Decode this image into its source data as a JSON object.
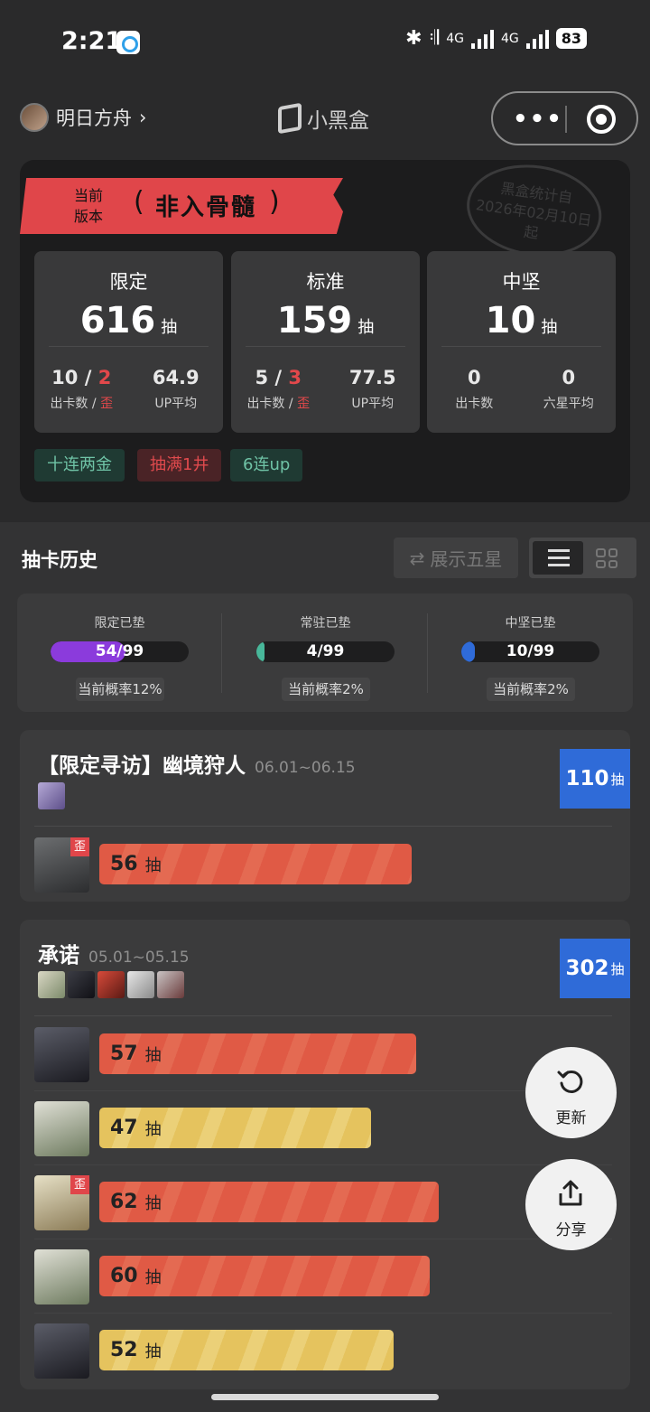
{
  "status": {
    "time": "2:21",
    "net1": "4G",
    "net2": "4G",
    "battery": "83"
  },
  "nav": {
    "game": "明日方舟",
    "brand": "小黑盒"
  },
  "summary": {
    "version_label_1": "当前",
    "version_label_2": "版本",
    "grade": "非入骨髓",
    "stamp_line1": "黑盒统计自",
    "stamp_line2": "2026年02月10日",
    "stamp_line3": "起",
    "unit": "抽",
    "boxes": [
      {
        "title": "限定",
        "pulls": "616",
        "cards": "10",
        "off": "2",
        "sep": "/",
        "avg": "64.9",
        "k1": "出卡数 /",
        "k1b": "歪",
        "k2": "UP平均"
      },
      {
        "title": "标准",
        "pulls": "159",
        "cards": "5",
        "off": "3",
        "sep": "/",
        "avg": "77.5",
        "k1": "出卡数 /",
        "k1b": "歪",
        "k2": "UP平均"
      },
      {
        "title": "中坚",
        "pulls": "10",
        "cards": "0",
        "avg": "0",
        "k1": "出卡数",
        "k2": "六星平均"
      }
    ],
    "tags": [
      "十连两金",
      "抽满1井",
      "6连up"
    ]
  },
  "history": {
    "title": "抽卡历史",
    "five_star_toggle": "展示五星",
    "pity": [
      {
        "label": "限定已垫",
        "value": "54/99",
        "progress": 0.545,
        "color": "#8b3bdc",
        "rate": "当前概率12%"
      },
      {
        "label": "常驻已垫",
        "value": "4/99",
        "progress": 0.04,
        "color": "#48b79a",
        "rate": "当前概率2%"
      },
      {
        "label": "中坚已垫",
        "value": "10/99",
        "progress": 0.1,
        "color": "#2f6bd8",
        "rate": "当前概率2%"
      }
    ]
  },
  "banners": [
    {
      "name": "【限定寻访】幽境狩人",
      "dates": "06.01~06.15",
      "total": "110",
      "unit": "抽",
      "pulls": [
        {
          "count": "56",
          "unit": "抽",
          "off_banner": true,
          "off_label": "歪",
          "color": "red"
        }
      ]
    },
    {
      "name": "承诺",
      "dates": "05.01~05.15",
      "total": "302",
      "unit": "抽",
      "pulls": [
        {
          "count": "57",
          "unit": "抽",
          "color": "red"
        },
        {
          "count": "47",
          "unit": "抽",
          "color": "yellow"
        },
        {
          "count": "62",
          "unit": "抽",
          "off_banner": true,
          "off_label": "歪",
          "color": "red"
        },
        {
          "count": "60",
          "unit": "抽",
          "color": "red"
        },
        {
          "count": "52",
          "unit": "抽",
          "color": "yellow"
        }
      ]
    }
  ],
  "fabs": {
    "refresh": "更新",
    "share": "分享"
  }
}
